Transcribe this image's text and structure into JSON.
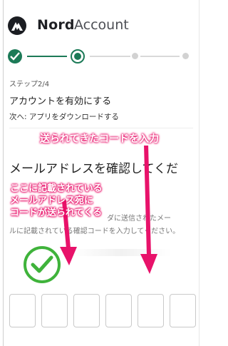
{
  "header": {
    "brand": "Nord",
    "section": "Account"
  },
  "stepper": {
    "total_steps": 4,
    "current_step": 2
  },
  "step": {
    "label": "ステップ2/4",
    "title": "アカウントを有効にする",
    "next": "次へ: アプリをダウンロードする"
  },
  "verify": {
    "title": "メールアドレスを確認してくだ",
    "desc_line1": "ダに送信されたメー",
    "desc_line2": "ルに記載されている確認コードを入力してください。"
  },
  "code_inputs": [
    "",
    "",
    "",
    "",
    "",
    ""
  ],
  "annotations": {
    "top": "送られてきたコードを入力",
    "left_line1": "ここに記載されている",
    "left_line2": "メールアドレス宛に",
    "left_line3": "コードが送られてくる"
  },
  "colors": {
    "accent_green": "#1c7a57",
    "annotation_pink": "#e8126a",
    "check_green": "#3fb33b"
  }
}
